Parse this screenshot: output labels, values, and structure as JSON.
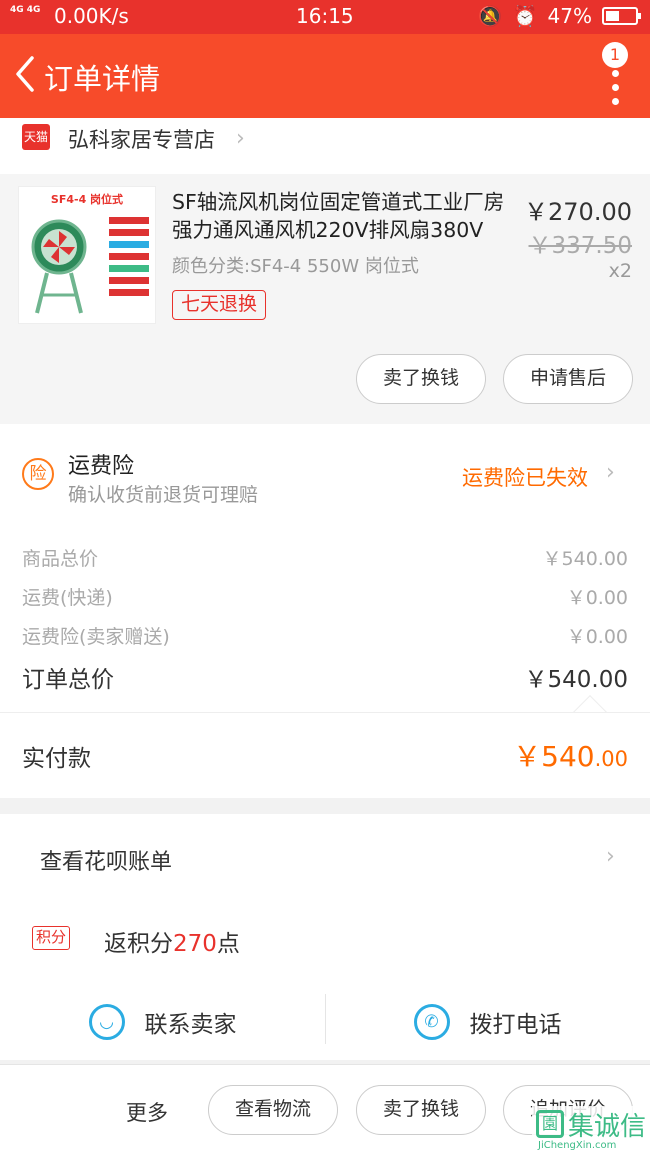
{
  "status_bar": {
    "network": "4G 4G",
    "speed": "0.00K/s",
    "time": "16:15",
    "battery": "47%"
  },
  "header": {
    "title": "订单详情",
    "badge_count": "1"
  },
  "shop": {
    "tag": "天猫",
    "name": "弘科家居专营店"
  },
  "product": {
    "image_label": "SF4-4 岗位式",
    "title": "SF轴流风机岗位固定管道式工业厂房强力通风通风机220V排风扇380V",
    "spec": "颜色分类:SF4-4 550W 岗位式",
    "tag": "七天退换",
    "price": "￥270.00",
    "original_price": "￥337.50",
    "quantity": "x2",
    "btn_sell": "卖了换钱",
    "btn_aftersale": "申请售后"
  },
  "insurance": {
    "icon": "险",
    "title": "运费险",
    "subtitle": "确认收货前退货可理赔",
    "status": "运费险已失效"
  },
  "prices": {
    "rows": [
      {
        "label": "商品总价",
        "value": "￥540.00"
      },
      {
        "label": "运费(快递)",
        "value": "￥0.00"
      },
      {
        "label": "运费险(卖家赠送)",
        "value": "￥0.00"
      }
    ],
    "total_label": "订单总价",
    "total_value": "￥540.00",
    "paid_label": "实付款",
    "paid_value_main": "￥540",
    "paid_value_cents": ".00"
  },
  "huabei": {
    "label": "查看花呗账单"
  },
  "points": {
    "tag": "积分",
    "prefix": "返积分",
    "number": "270",
    "suffix": "点"
  },
  "contact": {
    "seller": "联系卖家",
    "phone": "拨打电话"
  },
  "actions": {
    "more": "更多",
    "logistics": "查看物流",
    "sell": "卖了换钱",
    "review": "追加评价"
  },
  "watermark": {
    "cn": "集诚信",
    "en": "JiChengXin.com"
  },
  "colors": {
    "header": "#f74b2a",
    "accent": "#ff6a00",
    "red": "#e8322c",
    "blue": "#2bace2"
  }
}
